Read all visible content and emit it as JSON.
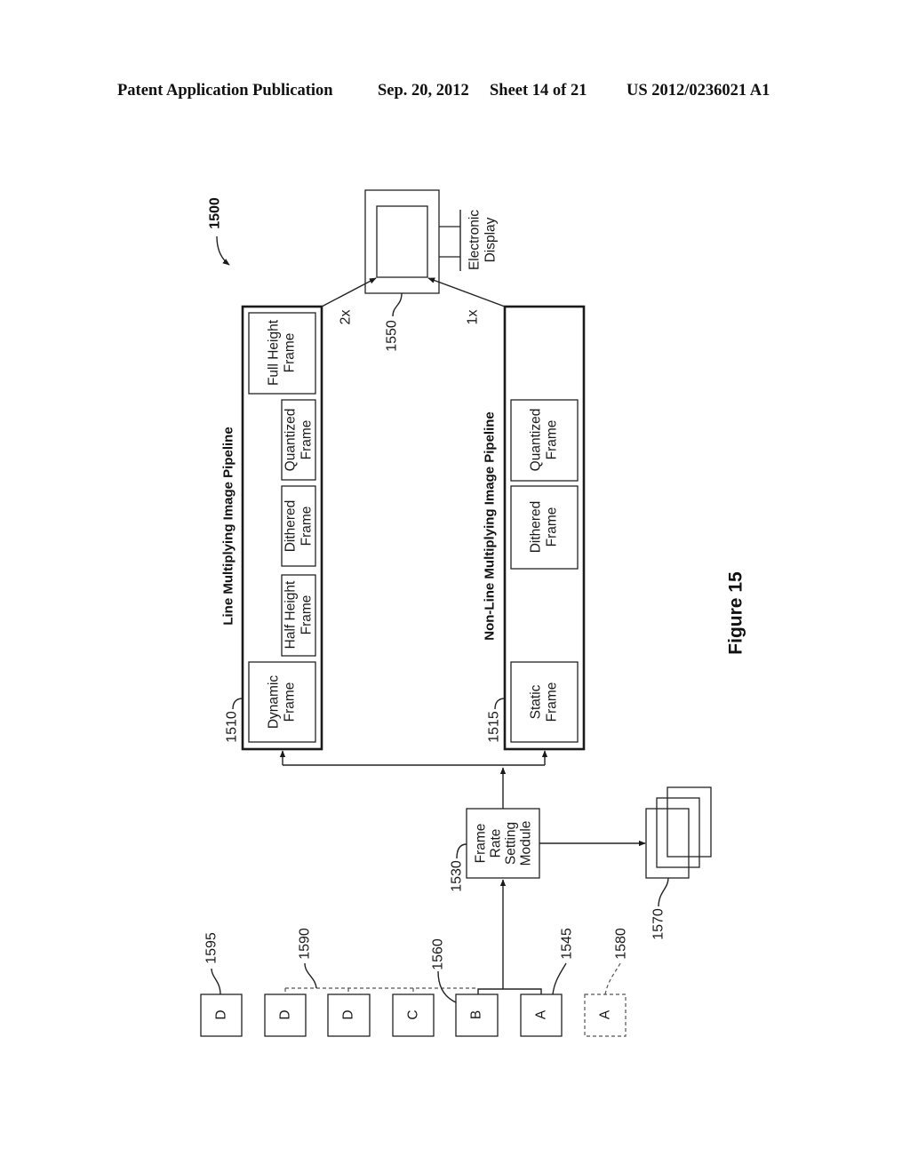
{
  "header": {
    "publication": "Patent Application Publication",
    "date": "Sep. 20, 2012",
    "sheet": "Sheet 14 of 21",
    "number": "US 2012/0236021 A1"
  },
  "figure": {
    "ref": "1500",
    "caption": "Figure 15"
  },
  "line_pipeline": {
    "ref": "1510",
    "title": "Line Multiplying Image Pipeline",
    "output_multiplier": "2x",
    "stages": [
      {
        "line1": "Dynamic",
        "line2": "Frame"
      },
      {
        "line1": "Half Height",
        "line2": "Frame"
      },
      {
        "line1": "Dithered",
        "line2": "Frame"
      },
      {
        "line1": "Quantized",
        "line2": "Frame"
      },
      {
        "line1": "Full Height",
        "line2": "Frame"
      }
    ]
  },
  "non_line_pipeline": {
    "ref": "1515",
    "title": "Non-Line Multiplying Image Pipeline",
    "output_multiplier": "1x",
    "stages": [
      {
        "line1": "Static",
        "line2": "Frame"
      },
      {
        "line1": "Dithered",
        "line2": "Frame"
      },
      {
        "line1": "Quantized",
        "line2": "Frame"
      }
    ]
  },
  "display": {
    "ref": "1550",
    "line1": "Electronic",
    "line2": "Display"
  },
  "frame_rate_module": {
    "ref": "1530",
    "lines": [
      "Frame",
      "Rate",
      "Setting",
      "Module"
    ]
  },
  "frame_buffer": {
    "ref": "1570"
  },
  "input_frames": {
    "items": [
      {
        "letter": "D",
        "style": "solid"
      },
      {
        "letter": "D",
        "style": "solid"
      },
      {
        "letter": "D",
        "style": "solid"
      },
      {
        "letter": "C",
        "style": "solid"
      },
      {
        "letter": "B",
        "style": "solid"
      },
      {
        "letter": "A",
        "style": "solid"
      },
      {
        "letter": "A",
        "style": "dashed"
      }
    ],
    "refs": {
      "last_frame": "1595",
      "repeated_group": "1590",
      "current_b": "1560",
      "current_a": "1545",
      "previous_a": "1580"
    }
  }
}
